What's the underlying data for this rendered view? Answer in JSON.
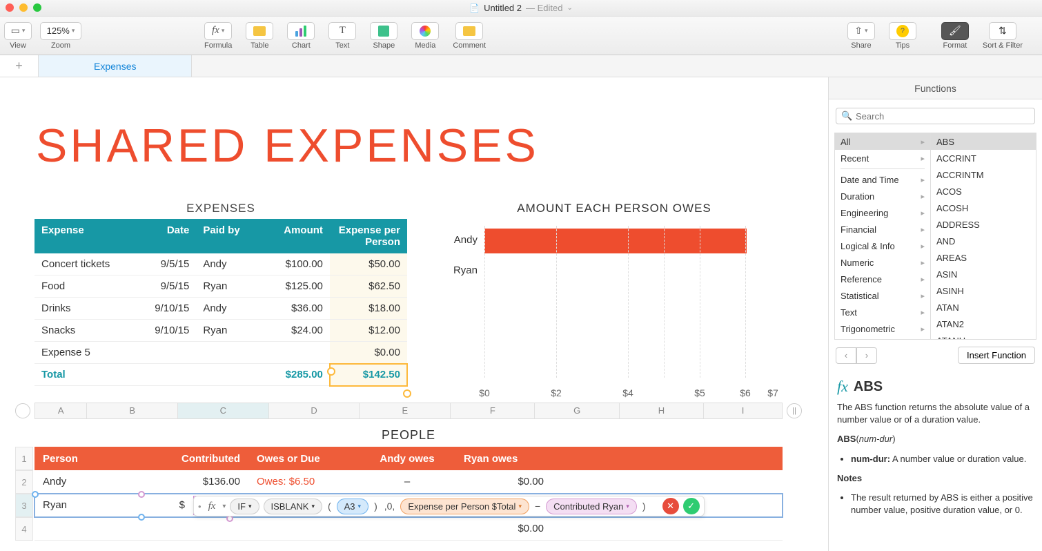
{
  "window": {
    "title": "Untitled 2",
    "edited": "— Edited"
  },
  "toolbar": {
    "view": "View",
    "zoom_val": "125%",
    "zoom": "Zoom",
    "formula": "Formula",
    "table": "Table",
    "chart": "Chart",
    "text": "Text",
    "shape": "Shape",
    "media": "Media",
    "comment": "Comment",
    "share": "Share",
    "tips": "Tips",
    "format": "Format",
    "sort": "Sort & Filter"
  },
  "tabs": {
    "name": "Expenses"
  },
  "big_title": "SHARED EXPENSES",
  "expenses": {
    "title": "EXPENSES",
    "headers": [
      "Expense",
      "Date",
      "Paid by",
      "Amount",
      "Expense per Person"
    ],
    "rows": [
      {
        "name": "Concert tickets",
        "date": "9/5/15",
        "paid": "Andy",
        "amount": "$100.00",
        "per": "$50.00"
      },
      {
        "name": "Food",
        "date": "9/5/15",
        "paid": "Ryan",
        "amount": "$125.00",
        "per": "$62.50"
      },
      {
        "name": "Drinks",
        "date": "9/10/15",
        "paid": "Andy",
        "amount": "$36.00",
        "per": "$18.00"
      },
      {
        "name": "Snacks",
        "date": "9/10/15",
        "paid": "Ryan",
        "amount": "$24.00",
        "per": "$12.00"
      },
      {
        "name": "Expense 5",
        "date": "",
        "paid": "",
        "amount": "",
        "per": "$0.00"
      }
    ],
    "total_label": "Total",
    "total_amount": "$285.00",
    "total_per": "$142.50"
  },
  "chart_data": {
    "type": "bar",
    "title": "AMOUNT EACH PERSON OWES",
    "categories": [
      "Andy",
      "Ryan"
    ],
    "values": [
      5.5,
      0
    ],
    "x_ticks": [
      "$0",
      "$2",
      "$4",
      "$5",
      "$6",
      "$7"
    ],
    "xlabel": "",
    "ylabel": ""
  },
  "cols": [
    "A",
    "B",
    "C",
    "D",
    "E",
    "F",
    "G",
    "H",
    "I"
  ],
  "people": {
    "title": "PEOPLE",
    "headers": [
      "Person",
      "Contributed",
      "Owes or Due",
      "Andy owes",
      "Ryan owes"
    ],
    "rows": [
      {
        "n": "1"
      },
      {
        "n": "2",
        "person": "Andy",
        "contrib": "$136.00",
        "owes": "Owes: $6.50",
        "p1": "–",
        "p2": "$0.00"
      },
      {
        "n": "3",
        "person": "Ryan",
        "contrib": "$"
      },
      {
        "n": "4",
        "person": "",
        "contrib": "",
        "owes": "",
        "p1": "",
        "p2": "$0.00"
      }
    ]
  },
  "formula": {
    "if": "IF",
    "isblank": "ISBLANK",
    "a3": "A3",
    "mid": ",0,",
    "tok1": "Expense per Person $Total",
    "minus": "−",
    "tok2": "Contributed Ryan"
  },
  "sidebar": {
    "title": "Functions",
    "search_placeholder": "Search",
    "categories": [
      "All",
      "Recent",
      "Date and Time",
      "Duration",
      "Engineering",
      "Financial",
      "Logical & Info",
      "Numeric",
      "Reference",
      "Statistical",
      "Text",
      "Trigonometric"
    ],
    "functions": [
      "ABS",
      "ACCRINT",
      "ACCRINTM",
      "ACOS",
      "ACOSH",
      "ADDRESS",
      "AND",
      "AREAS",
      "ASIN",
      "ASINH",
      "ATAN",
      "ATAN2",
      "ATANH"
    ],
    "insert": "Insert Function",
    "help": {
      "name": "ABS",
      "desc": "The ABS function returns the absolute value of a number value or of a duration value.",
      "sig_fn": "ABS",
      "sig_arg": "num-dur",
      "arg_name": "num-dur:",
      "arg_desc": "A number value or duration value.",
      "notes_label": "Notes",
      "note1": "The result returned by ABS is either a positive number value, positive duration value, or 0."
    }
  }
}
